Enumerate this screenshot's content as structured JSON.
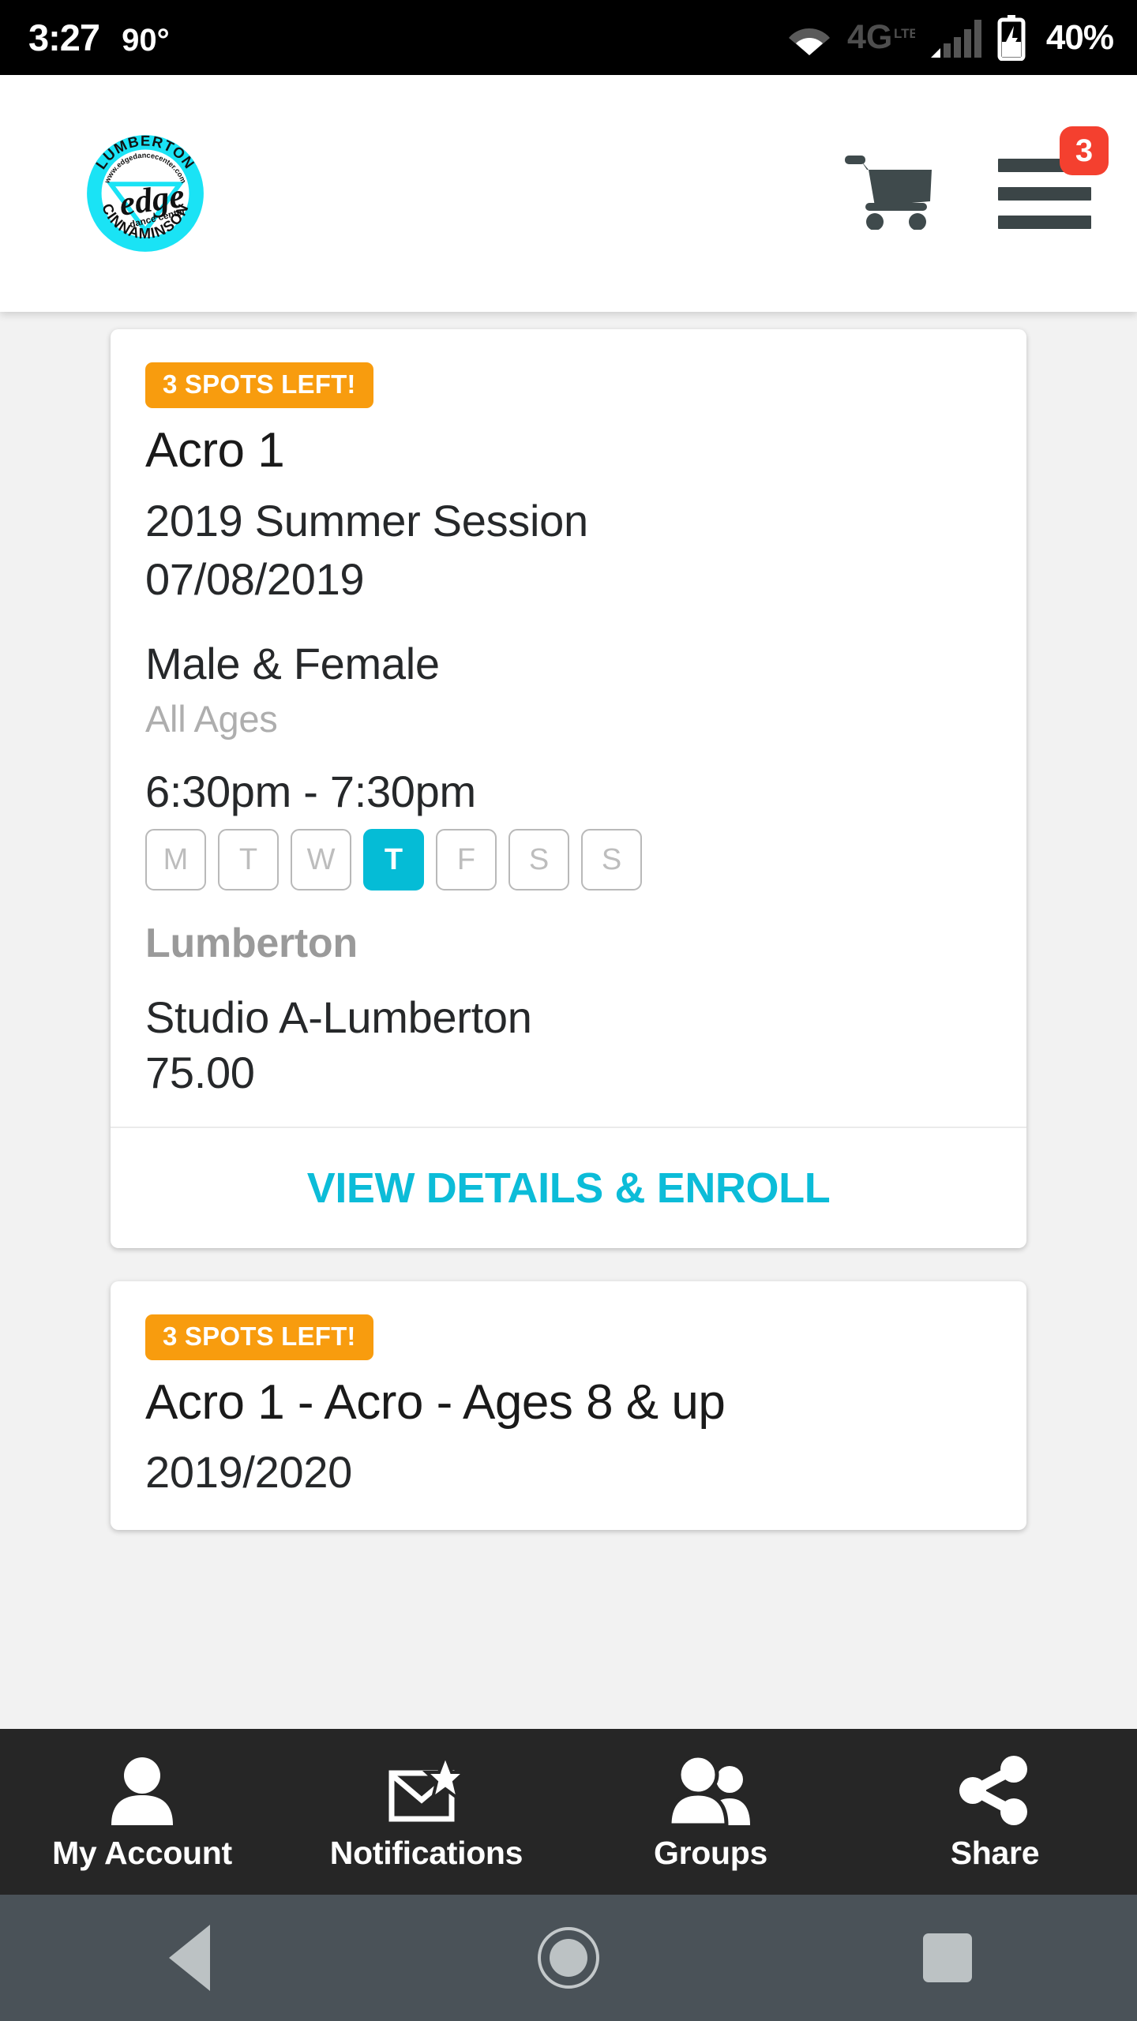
{
  "statusbar": {
    "time": "3:27",
    "temperature": "90°",
    "wifi_icon": "wifi-icon",
    "network_label": "4G",
    "network_sublabel": "LTE",
    "signal_icon": "signal-bars-icon",
    "battery_icon": "battery-charging-icon",
    "battery_percent": "40%"
  },
  "header": {
    "logo": {
      "name": "edge-dance-center-logo",
      "top_arc": "LUMBERTON",
      "bottom_arc": "CINNAMINSON",
      "website": "www.edgedancecenter.com",
      "wordmark": "edge",
      "subtitle": "dance center"
    },
    "cart_icon": "shopping-cart-icon",
    "menu_icon": "hamburger-menu-icon",
    "menu_badge_count": "3"
  },
  "colors": {
    "accent_cyan": "#05bcd6",
    "badge_orange": "#f89c0e",
    "badge_red": "#f4402f",
    "icon_dark": "#3b4547",
    "page_background": "#f2f2f2",
    "tabbar_background": "#262626",
    "navbar_background": "#4a5258"
  },
  "cards": [
    {
      "spots_badge": "3 SPOTS LEFT!",
      "title": "Acro 1",
      "session": "2019 Summer Session",
      "date": "07/08/2019",
      "gender": "Male & Female",
      "ages": "All Ages",
      "time": "6:30pm - 7:30pm",
      "days": [
        {
          "label": "M",
          "selected": false
        },
        {
          "label": "T",
          "selected": false
        },
        {
          "label": "W",
          "selected": false
        },
        {
          "label": "T",
          "selected": true
        },
        {
          "label": "F",
          "selected": false
        },
        {
          "label": "S",
          "selected": false
        },
        {
          "label": "S",
          "selected": false
        }
      ],
      "location": "Lumberton",
      "studio": "Studio A-Lumberton",
      "price": "75.00",
      "cta": "VIEW DETAILS & ENROLL"
    },
    {
      "spots_badge": "3 SPOTS LEFT!",
      "title": "Acro 1 - Acro - Ages 8 & up",
      "session": "2019/2020"
    }
  ],
  "tabbar": [
    {
      "label": "My Account",
      "icon": "person-icon"
    },
    {
      "label": "Notifications",
      "icon": "envelope-star-icon"
    },
    {
      "label": "Groups",
      "icon": "people-group-icon"
    },
    {
      "label": "Share",
      "icon": "share-nodes-icon"
    }
  ],
  "navbar": [
    {
      "name": "back-button",
      "icon": "triangle-back-icon"
    },
    {
      "name": "home-button",
      "icon": "circle-home-icon"
    },
    {
      "name": "recents-button",
      "icon": "square-recents-icon"
    }
  ]
}
